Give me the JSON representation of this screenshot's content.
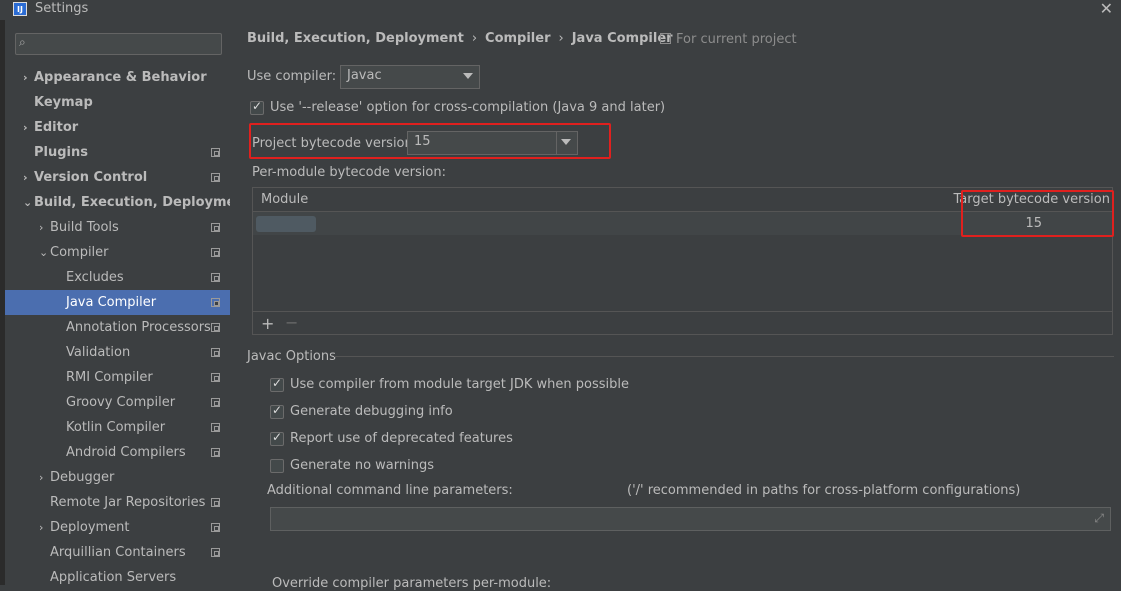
{
  "window": {
    "title": "Settings",
    "app_icon": "IJ",
    "close_glyph": "✕"
  },
  "sidebar": {
    "search": {
      "placeholder": "",
      "icon": "search-icon"
    },
    "items": [
      {
        "label": "Appearance & Behavior",
        "bold": true,
        "arrow": "›",
        "level": 0,
        "project_icon": false
      },
      {
        "label": "Keymap",
        "bold": true,
        "arrow": "",
        "level": 0,
        "project_icon": false
      },
      {
        "label": "Editor",
        "bold": true,
        "arrow": "›",
        "level": 0,
        "project_icon": false
      },
      {
        "label": "Plugins",
        "bold": true,
        "arrow": "",
        "level": 0,
        "project_icon": true
      },
      {
        "label": "Version Control",
        "bold": true,
        "arrow": "›",
        "level": 0,
        "project_icon": true
      },
      {
        "label": "Build, Execution, Deployment",
        "bold": true,
        "arrow": "⌄",
        "level": 0,
        "project_icon": false
      },
      {
        "label": "Build Tools",
        "bold": false,
        "arrow": "›",
        "level": 1,
        "project_icon": true
      },
      {
        "label": "Compiler",
        "bold": false,
        "arrow": "⌄",
        "level": 1,
        "project_icon": true
      },
      {
        "label": "Excludes",
        "bold": false,
        "arrow": "",
        "level": 2,
        "project_icon": true
      },
      {
        "label": "Java Compiler",
        "bold": false,
        "arrow": "",
        "level": 2,
        "project_icon": true,
        "selected": true
      },
      {
        "label": "Annotation Processors",
        "bold": false,
        "arrow": "",
        "level": 2,
        "project_icon": true
      },
      {
        "label": "Validation",
        "bold": false,
        "arrow": "",
        "level": 2,
        "project_icon": true
      },
      {
        "label": "RMI Compiler",
        "bold": false,
        "arrow": "",
        "level": 2,
        "project_icon": true
      },
      {
        "label": "Groovy Compiler",
        "bold": false,
        "arrow": "",
        "level": 2,
        "project_icon": true
      },
      {
        "label": "Kotlin Compiler",
        "bold": false,
        "arrow": "",
        "level": 2,
        "project_icon": true
      },
      {
        "label": "Android Compilers",
        "bold": false,
        "arrow": "",
        "level": 2,
        "project_icon": true
      },
      {
        "label": "Debugger",
        "bold": false,
        "arrow": "›",
        "level": 1,
        "project_icon": false
      },
      {
        "label": "Remote Jar Repositories",
        "bold": false,
        "arrow": "",
        "level": 1,
        "project_icon": true
      },
      {
        "label": "Deployment",
        "bold": false,
        "arrow": "›",
        "level": 1,
        "project_icon": true
      },
      {
        "label": "Arquillian Containers",
        "bold": false,
        "arrow": "",
        "level": 1,
        "project_icon": true
      },
      {
        "label": "Application Servers",
        "bold": false,
        "arrow": "",
        "level": 1,
        "project_icon": false
      }
    ]
  },
  "breadcrumb": {
    "items": [
      "Build, Execution, Deployment",
      "Compiler",
      "Java Compiler"
    ],
    "separator": "›"
  },
  "scope_hint": "For current project",
  "use_compiler": {
    "label": "Use compiler:",
    "value": "Javac"
  },
  "release_option": {
    "label": "Use '--release' option for cross-compilation (Java 9 and later)",
    "checked": true
  },
  "project_bytecode": {
    "label": "Project bytecode version:",
    "value": "15"
  },
  "per_module": {
    "label": "Per-module bytecode version:",
    "columns": [
      "Module",
      "Target bytecode version"
    ],
    "rows": [
      {
        "module": "",
        "target": "15"
      }
    ],
    "add": "+",
    "remove": "−"
  },
  "javac_options": {
    "title": "Javac Options",
    "checkboxes": [
      {
        "label": "Use compiler from module target JDK when possible",
        "checked": true
      },
      {
        "label": "Generate debugging info",
        "checked": true
      },
      {
        "label": "Report use of deprecated features",
        "checked": true
      },
      {
        "label": "Generate no warnings",
        "checked": false
      }
    ],
    "additional_params_label": "Additional command line parameters:",
    "additional_params_hint": "('/' recommended in paths for cross-platform configurations)",
    "additional_params_value": "",
    "override_label": "Override compiler parameters per-module:"
  },
  "colors": {
    "selection": "#4b6eaf",
    "highlight": "#e0201e",
    "background": "#3c3f41"
  }
}
